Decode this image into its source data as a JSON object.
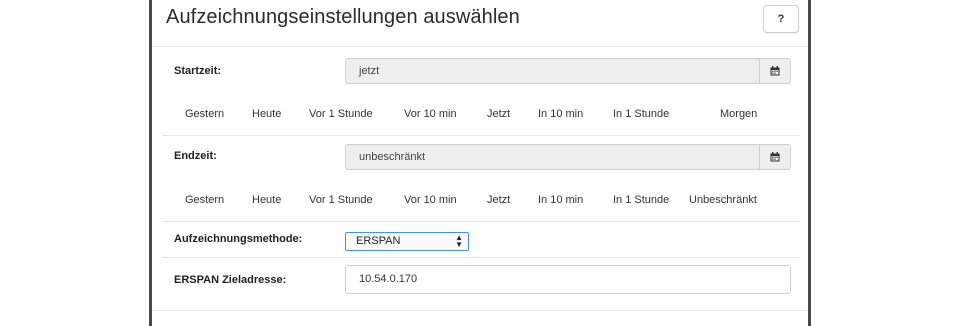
{
  "dialog": {
    "title": "Aufzeichnungseinstellungen auswählen",
    "help_label": "?"
  },
  "start": {
    "label": "Startzeit:",
    "value": "jetzt",
    "calendar_icon": "calendar-icon",
    "quick": [
      "Gestern",
      "Heute",
      "Vor 1 Stunde",
      "Vor 10 min",
      "Jetzt",
      "In 10 min",
      "In 1 Stunde",
      "Morgen"
    ]
  },
  "end": {
    "label": "Endzeit:",
    "value": "unbeschränkt",
    "calendar_icon": "calendar-icon",
    "quick": [
      "Gestern",
      "Heute",
      "Vor 1 Stunde",
      "Vor 10 min",
      "Jetzt",
      "In 10 min",
      "In 1 Stunde",
      "Unbeschränkt"
    ]
  },
  "method": {
    "label": "Aufzeichnungsmethode:",
    "selected": "ERSPAN"
  },
  "erspan": {
    "label": "ERSPAN Zieladresse:",
    "value": "10.54.0.170"
  },
  "colors": {
    "border": "#4a4a4a",
    "field_bg": "#eeeeee",
    "focus": "#4a90d9"
  }
}
